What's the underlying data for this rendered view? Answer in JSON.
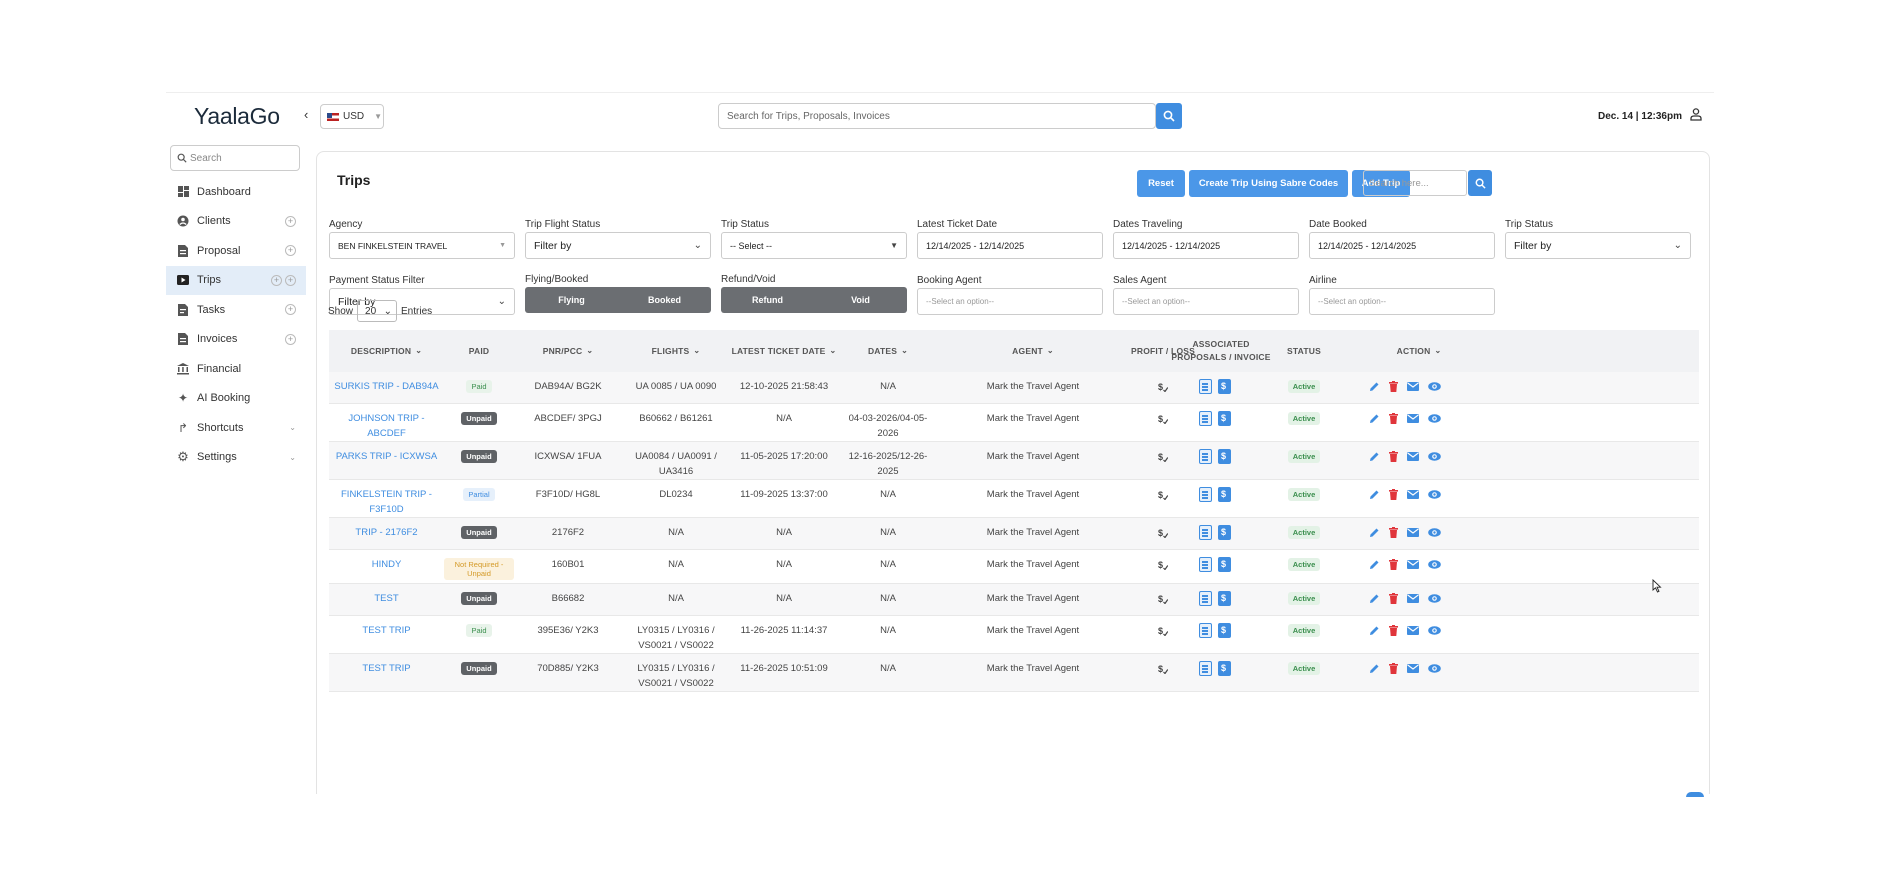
{
  "app": {
    "logo": "YaalaGo",
    "currency": "USD",
    "search_placeholder": "Search for Trips, Proposals, Invoices",
    "datetime": "Dec. 14 | 12:36pm"
  },
  "sidebar": {
    "search_placeholder": "Search",
    "items": [
      {
        "label": "Dashboard",
        "icon": "dashboard-icon"
      },
      {
        "label": "Clients",
        "icon": "clients-icon"
      },
      {
        "label": "Proposal",
        "icon": "proposal-icon"
      },
      {
        "label": "Trips",
        "icon": "trips-icon",
        "active": true
      },
      {
        "label": "Tasks",
        "icon": "tasks-icon"
      },
      {
        "label": "Invoices",
        "icon": "invoices-icon"
      },
      {
        "label": "Financial",
        "icon": "financial-icon"
      },
      {
        "label": "AI Booking",
        "icon": "ai-booking-icon"
      },
      {
        "label": "Shortcuts",
        "icon": "shortcuts-icon"
      },
      {
        "label": "Settings",
        "icon": "settings-icon"
      }
    ]
  },
  "main": {
    "title": "Trips",
    "buttons": {
      "reset": "Reset",
      "create_sabre": "Create Trip Using Sabre Codes",
      "add_trip": "Add Trip"
    },
    "search_placeholder": "Search here..."
  },
  "filters": {
    "agency": {
      "label": "Agency",
      "value": "BEN FINKELSTEIN TRAVEL"
    },
    "trip_flight_status": {
      "label": "Trip Flight Status",
      "value": "Filter by"
    },
    "trip_status": {
      "label": "Trip Status",
      "value": "-- Select --"
    },
    "latest_ticket_date": {
      "label": "Latest Ticket Date",
      "value": "12/14/2025 - 12/14/2025"
    },
    "dates_traveling": {
      "label": "Dates Traveling",
      "value": "12/14/2025 - 12/14/2025"
    },
    "date_booked": {
      "label": "Date Booked",
      "value": "12/14/2025 - 12/14/2025"
    },
    "trip_status_2": {
      "label": "Trip Status",
      "value": "Filter by"
    },
    "payment_status": {
      "label": "Payment Status Filter",
      "value": "Filter by"
    },
    "flying_booked": {
      "label": "Flying/Booked",
      "options": [
        "Flying",
        "Booked"
      ]
    },
    "refund_void": {
      "label": "Refund/Void",
      "options": [
        "Refund",
        "Void"
      ]
    },
    "booking_agent": {
      "label": "Booking Agent",
      "placeholder": "--Select an option--"
    },
    "sales_agent": {
      "label": "Sales Agent",
      "placeholder": "--Select an option--"
    },
    "airline": {
      "label": "Airline",
      "placeholder": "--Select an option--"
    }
  },
  "entries": {
    "show": "Show",
    "value": "20",
    "suffix": "Entries"
  },
  "table": {
    "headers": [
      "DESCRIPTION",
      "PAID",
      "PNR/PCC",
      "FLIGHTS",
      "LATEST TICKET DATE",
      "DATES",
      "AGENT",
      "PROFIT / LOSS",
      "ASSOCIATED PROPOSALS / INVOICE",
      "STATUS",
      "ACTION"
    ],
    "rows": [
      {
        "description": "SURKIS TRIP - DAB94A",
        "paid": "Paid",
        "paid_type": "paid",
        "pnr": "DAB94A/ BG2K",
        "flights": "UA 0085 / UA 0090",
        "ticket_date": "12-10-2025 21:58:43",
        "dates": "N/A",
        "agent": "Mark the Travel Agent",
        "status": "Active"
      },
      {
        "description": "JOHNSON TRIP - ABCDEF",
        "paid": "Unpaid",
        "paid_type": "unpaid",
        "pnr": "ABCDEF/ 3PGJ",
        "flights": "B60662 / B61261",
        "ticket_date": "N/A",
        "dates": "04-03-2026/04-05-2026",
        "agent": "Mark the Travel Agent",
        "status": "Active"
      },
      {
        "description": "PARKS TRIP - ICXWSA",
        "paid": "Unpaid",
        "paid_type": "unpaid",
        "pnr": "ICXWSA/ 1FUA",
        "flights": "UA0084 / UA0091 / UA3416",
        "ticket_date": "11-05-2025 17:20:00",
        "dates": "12-16-2025/12-26-2025",
        "agent": "Mark the Travel Agent",
        "status": "Active"
      },
      {
        "description": "FINKELSTEIN TRIP - F3F10D",
        "paid": "Partial",
        "paid_type": "partial",
        "pnr": "F3F10D/ HG8L",
        "flights": "DL0234",
        "ticket_date": "11-09-2025 13:37:00",
        "dates": "N/A",
        "agent": "Mark the Travel Agent",
        "status": "Active"
      },
      {
        "description": "TRIP - 2176F2",
        "paid": "Unpaid",
        "paid_type": "unpaid",
        "pnr": "2176F2",
        "flights": "N/A",
        "ticket_date": "N/A",
        "dates": "N/A",
        "agent": "Mark the Travel Agent",
        "status": "Active"
      },
      {
        "description": "HINDY",
        "paid": "Not Required - Unpaid",
        "paid_type": "nr",
        "pnr": "160B01",
        "flights": "N/A",
        "ticket_date": "N/A",
        "dates": "N/A",
        "agent": "Mark the Travel Agent",
        "status": "Active"
      },
      {
        "description": "TEST",
        "paid": "Unpaid",
        "paid_type": "unpaid",
        "pnr": "B66682",
        "flights": "N/A",
        "ticket_date": "N/A",
        "dates": "N/A",
        "agent": "Mark the Travel Agent",
        "status": "Active"
      },
      {
        "description": "TEST TRIP",
        "paid": "Paid",
        "paid_type": "paid",
        "pnr": "395E36/ Y2K3",
        "flights": "LY0315 / LY0316 / VS0021 / VS0022",
        "ticket_date": "11-26-2025 11:14:37",
        "dates": "N/A",
        "agent": "Mark the Travel Agent",
        "status": "Active"
      },
      {
        "description": "TEST TRIP",
        "paid": "Unpaid",
        "paid_type": "unpaid",
        "pnr": "70D885/ Y2K3",
        "flights": "LY0315 / LY0316 / VS0021 / VS0022",
        "ticket_date": "11-26-2025 10:51:09",
        "dates": "N/A",
        "agent": "Mark the Travel Agent",
        "status": "Active"
      }
    ]
  },
  "colors": {
    "accent": "#3f8de0",
    "button": "#4b97e8",
    "delete": "#e0353b",
    "toggle": "#6b6e72"
  }
}
